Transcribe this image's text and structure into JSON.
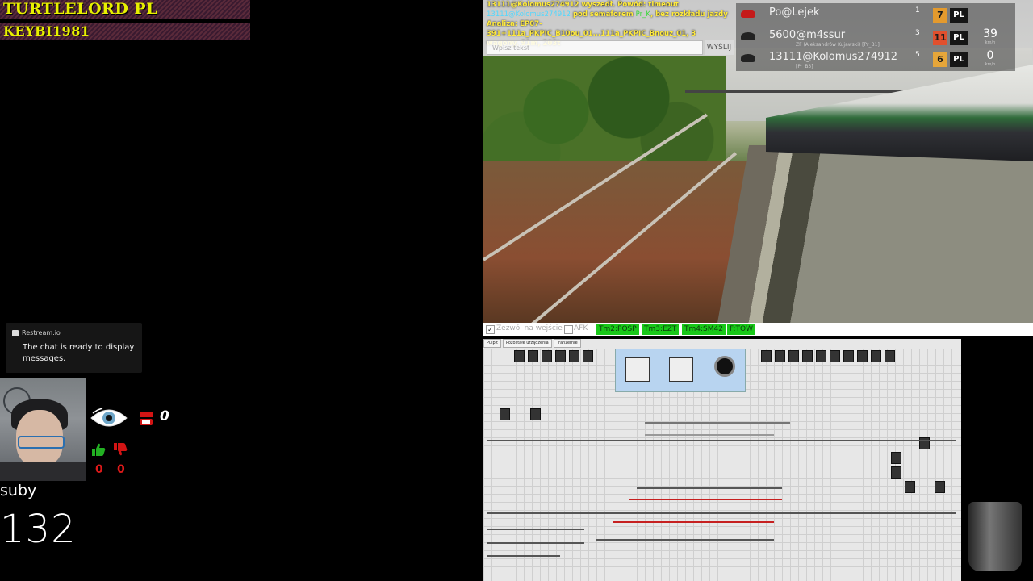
{
  "stream": {
    "banner_top": "TURTLELORD PL",
    "banner_bottom": "KEYBI1981",
    "restream_brand": "Restream.io",
    "chat_status": "The chat is ready to display messages.",
    "youtube_viewers": "0",
    "likes": "0",
    "dislikes": "0",
    "label": "suby",
    "sub_count": "132"
  },
  "game": {
    "chat_lines": [
      {
        "text": "13111@Kolomus274912 wyszedł. Powód: timeout",
        "color": "y"
      },
      {
        "text": "13111@Kolomus274912",
        "color": "c",
        "suffix": " pod semaforem ",
        "signal": "Pr_K",
        "suffix2": ", bez rozkładu jazdy"
      },
      {
        "text": "Analiza: EP07-391+111a_PKPIC_B10ou_01...111a_PKPIC_Bnouz_01, 3 wagony, 91m, 203t",
        "color": "y"
      }
    ],
    "chat_placeholder": "Wpisz tekst",
    "send_label": "WYŚLIJ",
    "players": [
      {
        "name": "Po@Lejek",
        "sub": "",
        "index": "1",
        "level": "7",
        "level_color": "#e39a2e",
        "flag": "PL",
        "speed": "",
        "unit": "",
        "hat": "red"
      },
      {
        "name": "5600@m4ssur",
        "sub": "ZF (Aleksandrów Kujawski) [Pr_B1]",
        "index": "3",
        "level": "11",
        "level_color": "#e0502e",
        "flag": "PL",
        "speed": "39",
        "unit": "km/h",
        "hat": "dark"
      },
      {
        "name": "13111@Kolomus274912",
        "sub": "[Pr_B3]",
        "index": "5",
        "level": "6",
        "level_color": "#e6a63a",
        "flag": "PL",
        "speed": "0",
        "unit": "km/h",
        "hat": "dark"
      }
    ],
    "status": {
      "allow_entry": "Zezwól na wejście",
      "afk": "AFK",
      "tags": [
        "Tm2:POSP",
        "Tm3:EZT",
        "Tm4:SM42",
        "F:TOW"
      ]
    },
    "panel_tabs": [
      "Pulpit",
      "Pozostałe urządzenia",
      "Tranzernie"
    ]
  }
}
